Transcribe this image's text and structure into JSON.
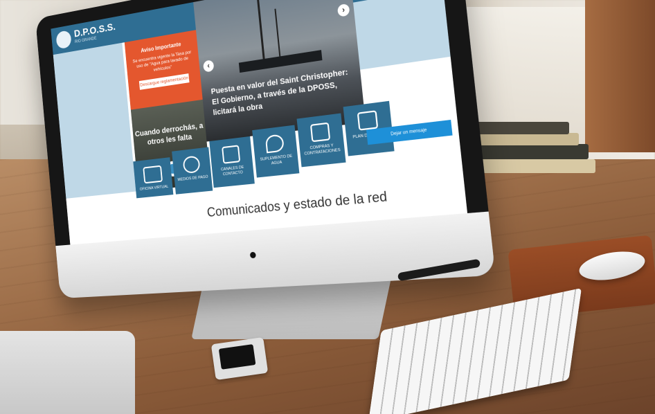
{
  "site": {
    "logo_title": "D.P.O.S.S.",
    "logo_subtitle": "RIO GRANDE"
  },
  "notice": {
    "title": "Aviso Importante",
    "body": "Se encuentra vigente la Tasa por uso de \"Agua para lavado de vehículos\"",
    "button": "Descargue reglamentación"
  },
  "promo": {
    "title": "Cuando derrochás, a otros les falta"
  },
  "slide": {
    "caption": "Puesta en valor del Saint Christopher: El Gobierno, a través de la DPOSS, licitará la obra",
    "prev": "‹",
    "next": "›"
  },
  "small_tiles": [
    {
      "label": "CANALES DE CONTACTO"
    },
    {
      "label": "SUPLEMENTO DE AGUA"
    },
    {
      "label": "COMPRAS Y CONTRATACIONES"
    },
    {
      "label": "PLAN DE OBRAS"
    }
  ],
  "big_tiles": [
    {
      "label": "OFICINA VIRTUAL"
    },
    {
      "label": "MEDIOS DE PAGO"
    }
  ],
  "cta": {
    "label": "Dejar un mensaje"
  },
  "section": {
    "title": "Comunicados y estado de la red"
  },
  "colors": {
    "brand": "#2f6e93",
    "accent": "#e4572e",
    "cta": "#1e90d8",
    "pane": "#bfd8e7"
  }
}
